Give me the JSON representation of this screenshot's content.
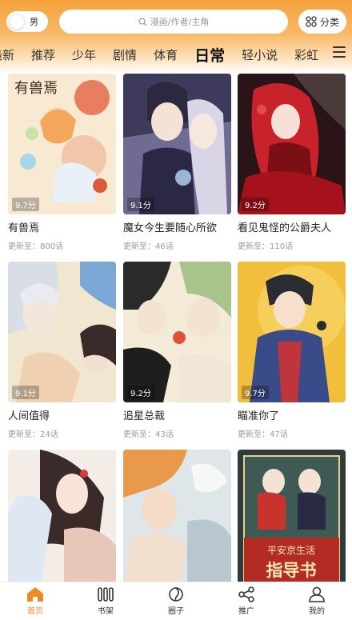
{
  "header": {
    "gender_toggle_label": "男",
    "search_placeholder": "漫画/作者/主角",
    "category_label": "分类"
  },
  "tabs": [
    "最新",
    "推荐",
    "少年",
    "剧情",
    "体育",
    "日常",
    "轻小说",
    "彩虹"
  ],
  "active_tab": "日常",
  "comics": [
    {
      "title": "有兽焉",
      "update": "更新至：800话",
      "score": "9.7分"
    },
    {
      "title": "魔女今生要随心所欲",
      "update": "更新至：46话",
      "score": "9.1分"
    },
    {
      "title": "看见鬼怪的公爵夫人",
      "update": "更新至：110话",
      "score": "9.2分"
    },
    {
      "title": "人间值得",
      "update": "更新至：24话",
      "score": "9.1分"
    },
    {
      "title": "追星总裁",
      "update": "更新至：43话",
      "score": "9.2分"
    },
    {
      "title": "瞄准你了",
      "update": "更新至：47话",
      "score": "9.7分"
    },
    {
      "title": "",
      "update": "",
      "score": ""
    },
    {
      "title": "",
      "update": "",
      "score": ""
    },
    {
      "title": "",
      "update": "",
      "score": ""
    }
  ],
  "cover_art_text": {
    "cover_1": "有兽焉",
    "cover_9_line1": "平安京生活",
    "cover_9_line2": "指导书"
  },
  "bottom_nav": [
    {
      "label": "首页",
      "icon": "home-icon",
      "active": true
    },
    {
      "label": "书架",
      "icon": "bookshelf-icon",
      "active": false
    },
    {
      "label": "圈子",
      "icon": "circle-icon",
      "active": false
    },
    {
      "label": "推广",
      "icon": "share-icon",
      "active": false
    },
    {
      "label": "我的",
      "icon": "profile-icon",
      "active": false
    }
  ],
  "colors": {
    "accent": "#f08a24",
    "header_top": "#f5a23c"
  }
}
